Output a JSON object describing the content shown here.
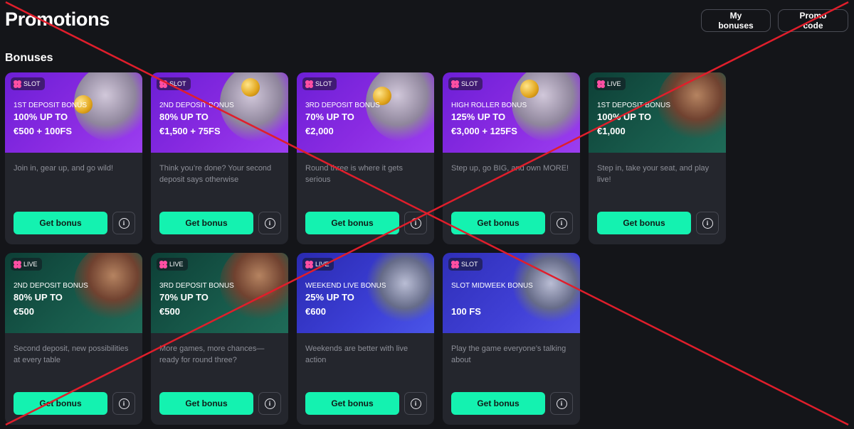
{
  "header": {
    "title": "Promotions",
    "my_bonuses": "My bonuses",
    "promo_code": "Promo code"
  },
  "section": {
    "title": "Bonuses"
  },
  "cards": [
    {
      "badge": "SLOT",
      "kicker": "1ST DEPOSIT BONUS",
      "line1": "100% UP TO",
      "line2": "€500 + 100FS",
      "desc": "Join in, gear up, and go wild!",
      "cta": "Get bonus"
    },
    {
      "badge": "SLOT",
      "kicker": "2ND DEPOSIT BONUS",
      "line1": "80% UP TO",
      "line2": "€1,500 + 75FS",
      "desc": "Think you’re done? Your second deposit says otherwise",
      "cta": "Get bonus"
    },
    {
      "badge": "SLOT",
      "kicker": "3RD DEPOSIT BONUS",
      "line1": "70% UP TO",
      "line2": "€2,000",
      "desc": "Round three is where it gets serious",
      "cta": "Get bonus"
    },
    {
      "badge": "SLOT",
      "kicker": "HIGH ROLLER BONUS",
      "line1": "125% UP TO",
      "line2": "€3,000 + 125FS",
      "desc": "Step up, go BIG, and own MORE!",
      "cta": "Get bonus"
    },
    {
      "badge": "LIVE",
      "kicker": "1ST DEPOSIT BONUS",
      "line1": "100% UP TO",
      "line2": "€1,000",
      "desc": "Step in, take your seat, and play live!",
      "cta": "Get bonus"
    },
    {
      "badge": "LIVE",
      "kicker": "2ND DEPOSIT BONUS",
      "line1": "80% UP TO",
      "line2": "€500",
      "desc": "Second deposit, new possibilities at every table",
      "cta": "Get bonus"
    },
    {
      "badge": "LIVE",
      "kicker": "3RD DEPOSIT BONUS",
      "line1": "70% UP TO",
      "line2": "€500",
      "desc": "More games, more chances—ready for round three?",
      "cta": "Get bonus"
    },
    {
      "badge": "LIVE",
      "kicker": "WEEKEND LIVE BONUS",
      "line1": "25% UP TO",
      "line2": "€600",
      "desc": "Weekends are better with live action",
      "cta": "Get bonus"
    },
    {
      "badge": "SLOT",
      "kicker": "SLOT MIDWEEK BONUS",
      "line1": "",
      "line2": "100 FS",
      "desc": "Play the game everyone’s talking about",
      "cta": "Get bonus"
    }
  ],
  "colors": {
    "background": "#141519",
    "card": "#24262d",
    "cta": "#14f2b0",
    "slot_purple": "#8a2be2",
    "live_green": "#17594a",
    "cross_red": "#e01e2b"
  }
}
